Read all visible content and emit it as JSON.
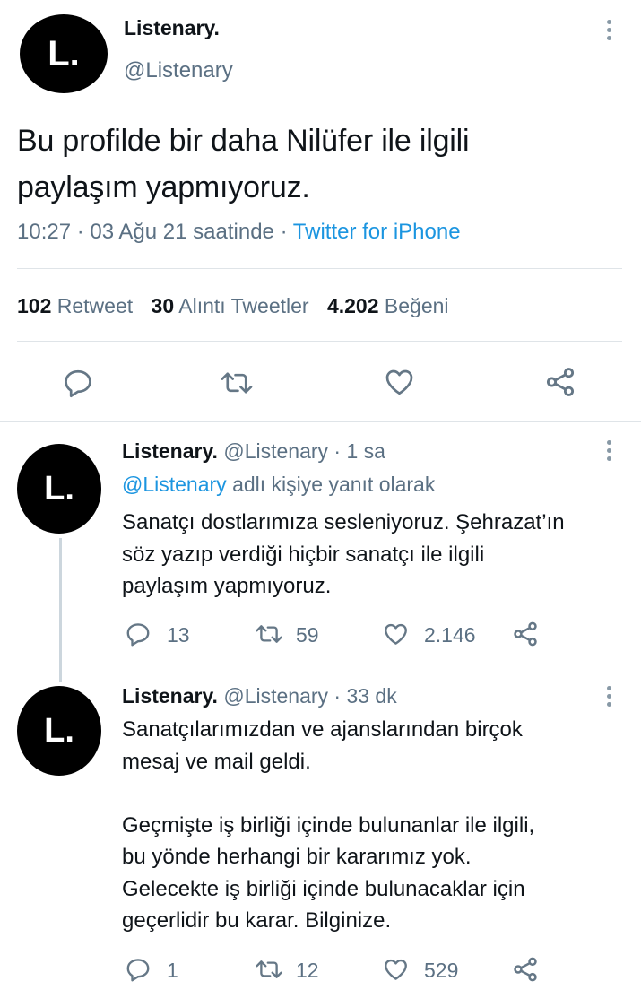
{
  "main_tweet": {
    "avatar_letter": "L.",
    "display_name": "Listenary.",
    "handle": "@Listenary",
    "text_line1": "Bu profilde bir daha Nilüfer ile ilgili",
    "text_line2": "paylaşım yapmıyoruz.",
    "time": "10:27 · 03 Ağu 21 saatinde ·",
    "source": "Twitter for iPhone",
    "stats": {
      "retweet_count": "102",
      "retweet_label": "Retweet",
      "quote_count": "30",
      "quote_label": "Alıntı Tweetler",
      "like_count": "4.202",
      "like_label": "Beğeni"
    }
  },
  "replies": [
    {
      "avatar_letter": "L.",
      "display_name": "Listenary.",
      "meta": "@Listenary · 1 sa",
      "reply_to_handle": "@Listenary",
      "reply_to_suffix": "adlı kişiye yanıt olarak",
      "text": "Sanatçı dostlarımıza sesleniyoruz. Şehrazat’ın\nsöz yazıp verdiği hiçbir sanatçı ile ilgili\npaylaşım yapmıyoruz.",
      "reply_count": "13",
      "retweet_count": "59",
      "like_count": "2.146"
    },
    {
      "avatar_letter": "L.",
      "display_name": "Listenary.",
      "meta": "@Listenary · 33 dk",
      "text": "Sanatçılarımızdan ve ajanslarından birçok\nmesaj ve mail geldi.\n\nGeçmişte iş birliği içinde bulunanlar ile ilgili,\nbu yönde herhangi bir kararımız yok.\nGelecekte iş birliği içinde bulunacaklar için\ngeçerlidir bu karar. Bilginize.",
      "reply_count": "1",
      "retweet_count": "12",
      "like_count": "529"
    }
  ],
  "icons": [
    "reply-icon",
    "retweet-icon",
    "like-icon",
    "share-icon",
    "more-icon"
  ]
}
